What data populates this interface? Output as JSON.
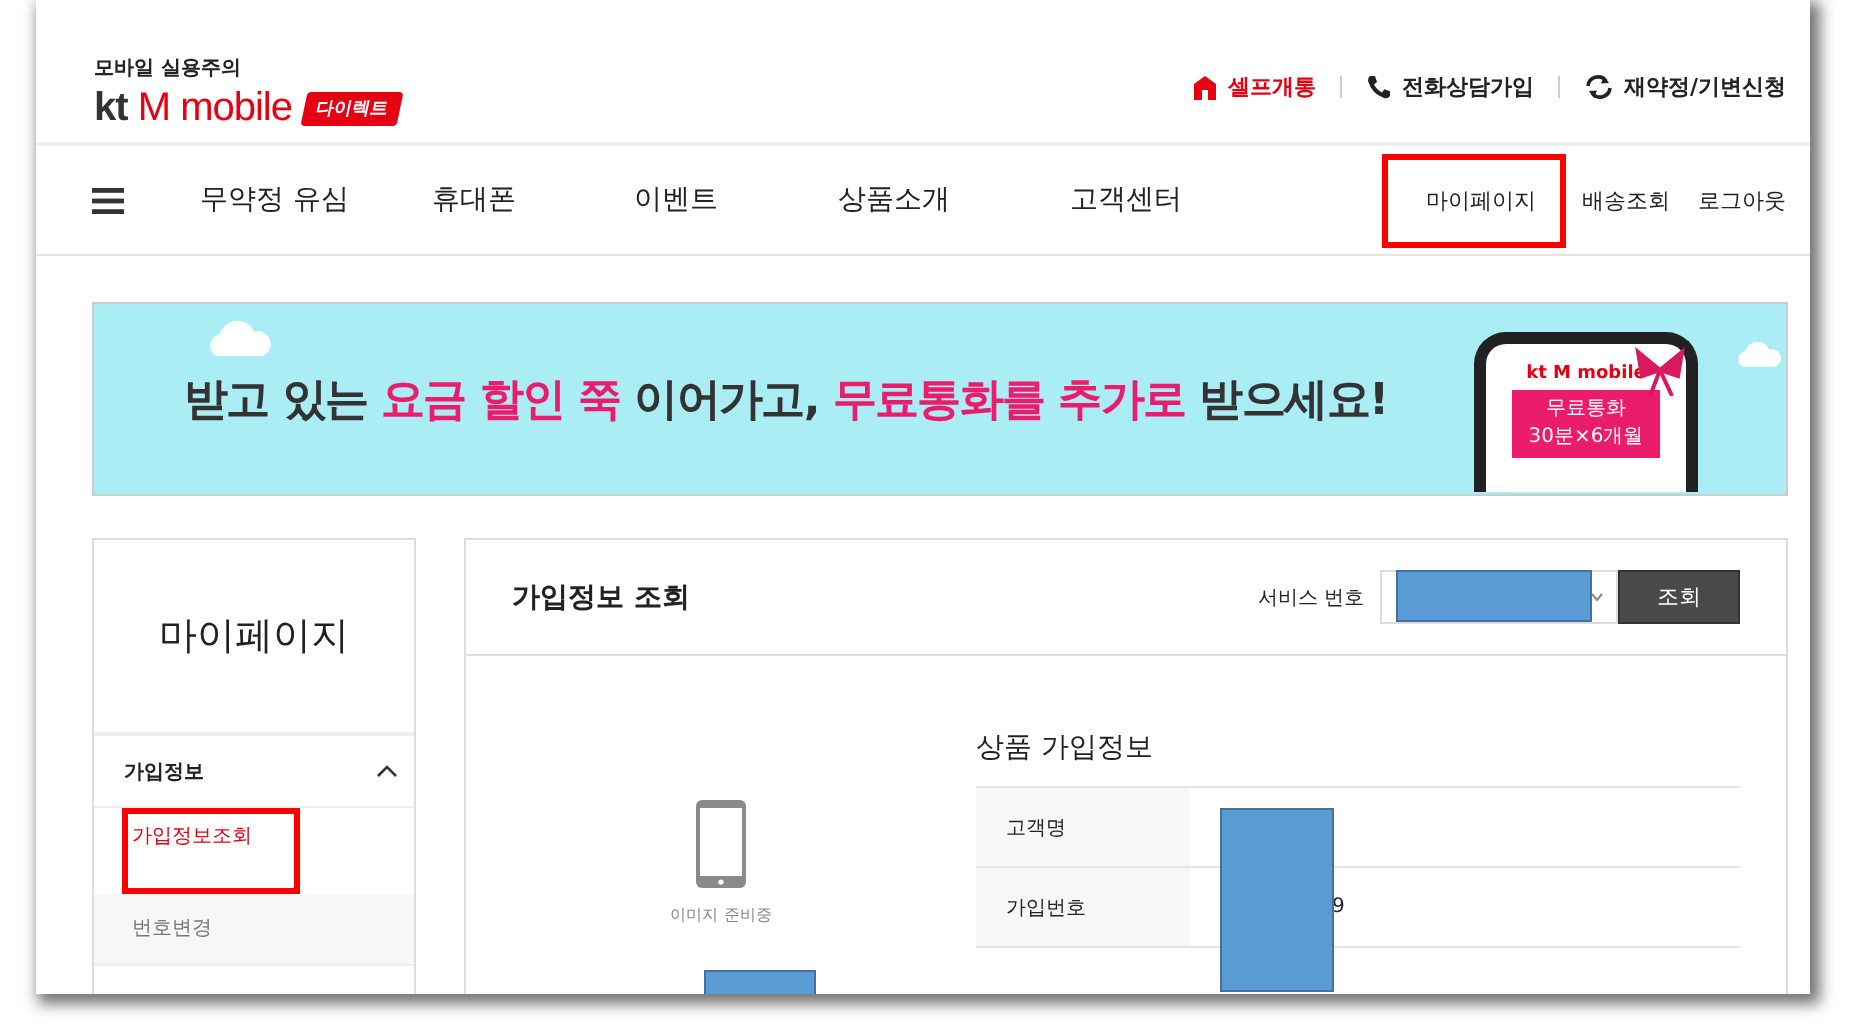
{
  "header": {
    "tagline": "모바일 실용주의",
    "logo_kt": "kt",
    "logo_brand": "M mobile",
    "logo_badge": "다이렉트",
    "top_links": [
      {
        "kind": "store",
        "label": "셀프개통"
      },
      {
        "kind": "phone",
        "label": "전화상담가입"
      },
      {
        "kind": "refresh",
        "label": "재약정/기변신청"
      }
    ]
  },
  "nav": {
    "items": [
      "무약정 유심",
      "휴대폰",
      "이벤트",
      "상품소개",
      "고객센터"
    ],
    "right_items": [
      {
        "label": "마이페이지",
        "highlighted": true
      },
      {
        "label": "배송조회",
        "highlighted": false
      },
      {
        "label": "로그아웃",
        "highlighted": false
      }
    ]
  },
  "banner": {
    "headline": "받고 있는 **요금 할인 쭉** 이어가고, **무료통화를 추가로** 받으세요!",
    "phone_logo": "kt M mobile",
    "phone_tag_line1": "무료통화",
    "phone_tag_line2": "30분×6개월"
  },
  "sidebar": {
    "title": "마이페이지",
    "groups": [
      {
        "label": "가입정보",
        "expanded": true,
        "children": [
          {
            "label": "가입정보조회",
            "selected": true,
            "highlighted": true
          },
          {
            "label": "번호변경",
            "selected": false,
            "highlighted": false
          }
        ]
      }
    ]
  },
  "main": {
    "title": "가입정보 조회",
    "service_label": "서비스 번호",
    "lookup_button": "조회",
    "image_caption": "이미지 준비중",
    "section_title": "상품 가입정보",
    "rows": [
      {
        "label": "고객명",
        "value": ""
      },
      {
        "label": "가입번호",
        "value": "9"
      }
    ]
  }
}
